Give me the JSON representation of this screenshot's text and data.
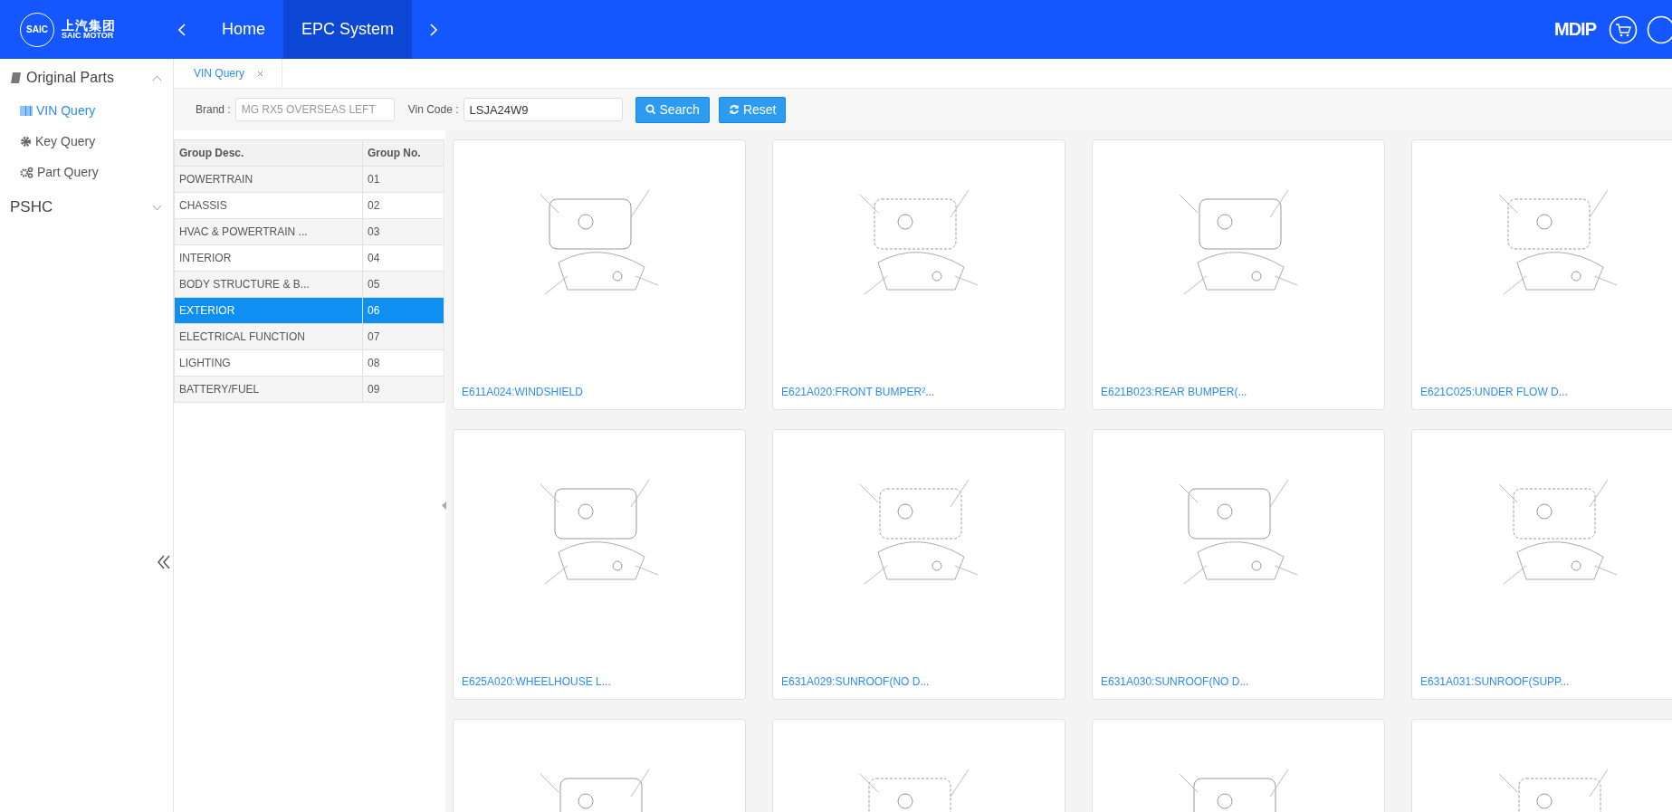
{
  "header": {
    "logo": {
      "badge": "SAIC",
      "chinese": "上汽集团",
      "english": "SAIC MOTOR"
    },
    "nav": [
      {
        "label": "Home",
        "selected": false
      },
      {
        "label": "EPC System",
        "selected": true
      }
    ],
    "brand_mark": "MDIP"
  },
  "sidebar": {
    "groups": [
      {
        "label": "Original Parts",
        "expanded": true,
        "children": [
          {
            "label": "VIN Query",
            "selected": true
          },
          {
            "label": "Key Query",
            "selected": false
          },
          {
            "label": "Part Query",
            "selected": false
          }
        ]
      },
      {
        "label": "PSHC",
        "expanded": false
      }
    ]
  },
  "tabs": [
    {
      "label": "VIN Query",
      "selected": true
    }
  ],
  "filters": {
    "brand": {
      "label": "Brand :",
      "value": "MG RX5 OVERSEAS LEFT"
    },
    "vin": {
      "label": "Vin Code :",
      "value": "LSJA24W9"
    },
    "buttons": [
      {
        "label": "Search"
      },
      {
        "label": "Reset"
      }
    ]
  },
  "table": {
    "columns": [
      "Group Desc.",
      "Group No."
    ],
    "rows": [
      {
        "desc": "POWERTRAIN",
        "no": "01",
        "selected": false
      },
      {
        "desc": "CHASSIS",
        "no": "02",
        "selected": false
      },
      {
        "desc": "HVAC & POWERTRAIN ...",
        "no": "03",
        "selected": false
      },
      {
        "desc": "INTERIOR",
        "no": "04",
        "selected": false
      },
      {
        "desc": "BODY STRUCTURE & B...",
        "no": "05",
        "selected": false
      },
      {
        "desc": "EXTERIOR",
        "no": "06",
        "selected": true
      },
      {
        "desc": "ELECTRICAL FUNCTION",
        "no": "07",
        "selected": false
      },
      {
        "desc": "LIGHTING",
        "no": "08",
        "selected": false
      },
      {
        "desc": "BATTERY/FUEL",
        "no": "09",
        "selected": false
      }
    ]
  },
  "cards": [
    {
      "kind": "full",
      "caption": "E611A024:WINDSHIELD"
    },
    {
      "kind": "full",
      "caption": "E621A020:FRONT BUMPER²..."
    },
    {
      "kind": "full",
      "caption": "E621B023:REAR BUMPER(..."
    },
    {
      "kind": "full",
      "caption": "E621C025:UNDER FLOW D..."
    },
    {
      "kind": "full",
      "caption": "E625A020:WHEELHOUSE L..."
    },
    {
      "kind": "full",
      "caption": "E631A029:SUNROOF(NO D..."
    },
    {
      "kind": "full",
      "caption": "E631A030:SUNROOF(NO D..."
    },
    {
      "kind": "full",
      "caption": "E631A031:SUNROOF(SUPP..."
    },
    {
      "kind": "cut_off"
    },
    {
      "kind": "cut_off"
    },
    {
      "kind": "cut_off"
    },
    {
      "kind": "cut_off"
    }
  ]
}
